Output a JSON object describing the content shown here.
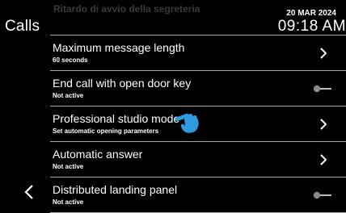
{
  "header": {
    "title": "Calls",
    "ghost_text": "Ritardo di avvio della segreteria",
    "date": "20 MAR 2024",
    "time": "09:18 AM"
  },
  "rows": [
    {
      "title": "Maximum message length",
      "subtitle": "60 seconds",
      "control": "chevron-right-icon"
    },
    {
      "title": "End call with open door key",
      "subtitle": "Not active",
      "control": "toggle-off"
    },
    {
      "title": "Professional studio mode",
      "subtitle": "Set automatic opening parameters",
      "control": "chevron-right-icon"
    },
    {
      "title": "Automatic answer",
      "subtitle": "Not active",
      "control": "chevron-right-icon"
    },
    {
      "title": "Distributed landing panel",
      "subtitle": "Not active",
      "control": "toggle-off"
    }
  ],
  "nav": {
    "back_icon": "chevron-left-icon"
  },
  "overlay": {
    "icon": "hand-pointer-icon",
    "color": "#2e9be0"
  }
}
